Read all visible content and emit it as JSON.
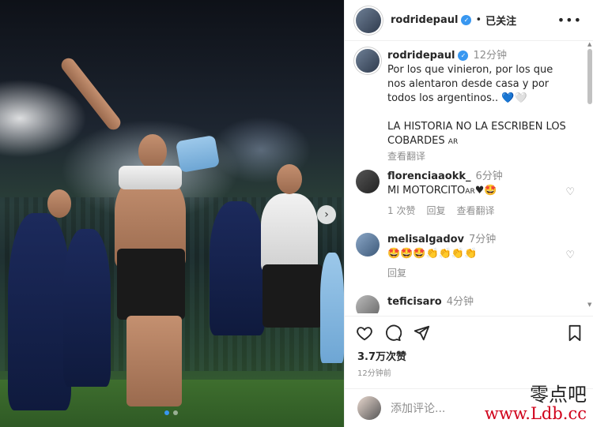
{
  "post": {
    "username": "rodridepaul",
    "follow_status": "已关注",
    "separator": "•"
  },
  "caption": {
    "username": "rodridepaul",
    "time": "12分钟",
    "text": "Por los que vinieron, por los que nos alentaron desde casa y por todos los argentinos..",
    "emoji": "💙🤍",
    "text2": "LA HISTORIA NO LA ESCRIBEN LOS COBARDES",
    "flag": "AR",
    "translate": "查看翻译"
  },
  "comments": [
    {
      "username": "florenciaaokk_",
      "time": "6分钟",
      "text": "MI MOTORCITO",
      "flag": "AR",
      "emoji": "♥🤩",
      "likes": "1 次赞",
      "reply": "回复",
      "translate": "查看翻译"
    },
    {
      "username": "melisalgadov",
      "time": "7分钟",
      "text": "🤩🤩🤩👏👏👏👏",
      "reply": "回复"
    },
    {
      "username": "teficisaro",
      "time": "4分钟"
    }
  ],
  "stats": {
    "likes": "3.7万次赞",
    "posted": "12分钟前"
  },
  "add_comment": {
    "placeholder": "添加评论..."
  },
  "watermark": {
    "line1": "零点吧",
    "line2": "www.Ldb.cc"
  },
  "colors": {
    "accent": "#3897f0",
    "text": "#262626",
    "secondary": "#8e8e8e",
    "watermark_red": "#d0021b"
  },
  "icons": [
    "verified-icon",
    "more-icon",
    "heart-icon",
    "comment-icon",
    "share-icon",
    "bookmark-icon",
    "next-arrow-icon"
  ],
  "carousel": {
    "current": 1,
    "total": 2
  }
}
